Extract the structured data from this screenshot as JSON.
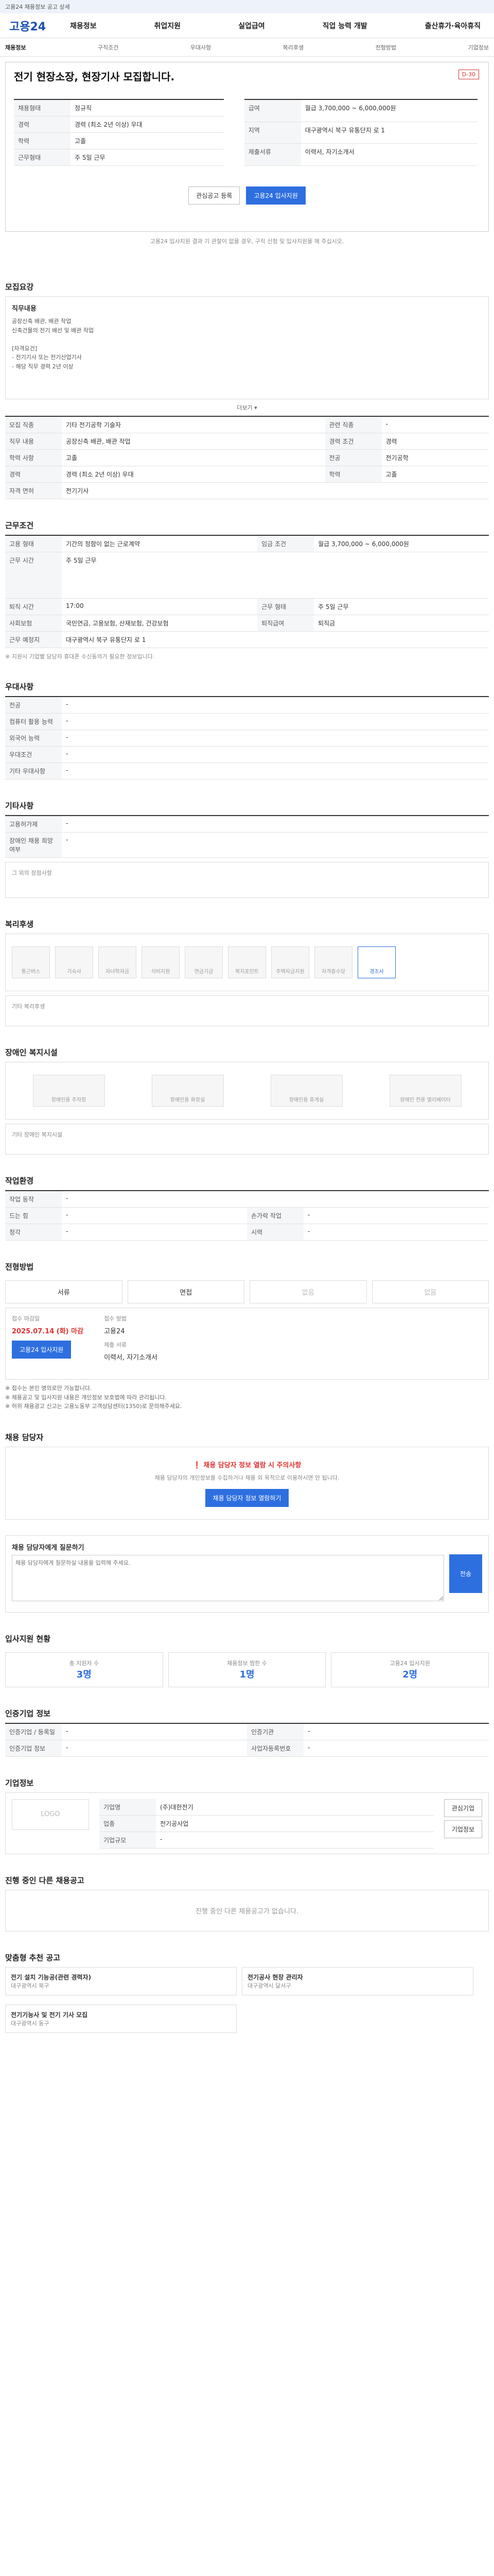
{
  "topbar": {
    "text": "고용24 채용정보 공고 상세"
  },
  "gnb": {
    "logo": "고용24",
    "menu": [
      "채용정보",
      "취업지원",
      "실업급여",
      "직업 능력 개발",
      "출산휴가·육아휴직"
    ]
  },
  "subnav": {
    "left": "채용정보",
    "crumbs": [
      "구직조건",
      "우대사항",
      "복리후생",
      "전형방법",
      "기업정보"
    ]
  },
  "job": {
    "title": "전기 현장소장, 현장기사 모집합니다.",
    "dday": "D-30",
    "left": [
      {
        "k": "채용형태",
        "v": "정규직"
      },
      {
        "k": "경력",
        "v": "경력 (최소 2년 이상) 우대"
      },
      {
        "k": "학력",
        "v": "고졸"
      },
      {
        "k": "근무형태",
        "v": "주 5일 근무"
      }
    ],
    "right": [
      {
        "k": "급여",
        "v": "월급 3,700,000 ~ 6,000,000원"
      },
      {
        "k": "지역",
        "v": "대구광역시 북구 유통단지 로 1"
      },
      {
        "k": "제출서류",
        "v": "이력서, 자기소개서"
      }
    ],
    "btn_save": "관심공고 등록",
    "btn_apply": "고용24 입사지원",
    "notice": "고용24 입사지원 결과 기 관찰이 없을 경우, 구직 신청 및 입사지원을 해 주십시오."
  },
  "recruit": {
    "title": "모집요강",
    "summary_title": "직무내용",
    "summary": "공장신축 배관, 배관 작업\n신축건물의 전기 배선 및 배관 작업\n\n[자격요건]\n- 전기기사 또는 전기산업기사\n- 해당 직무 경력 2년 이상",
    "more": "더보기 ▾",
    "rows": [
      {
        "k": "모집 직종",
        "v": "기타 전기공학 기술자",
        "k2": "관련 직종",
        "v2": "-"
      },
      {
        "k": "직무 내용",
        "v": "공장신축 배관, 배관 작업",
        "k2": "경력 조건",
        "v2": "경력"
      },
      {
        "k": "학력 사항",
        "v": "고졸",
        "k2": "전공",
        "v2": "전기공학"
      },
      {
        "k": "경력",
        "v": "경력 (최소 2년 이상) 우대",
        "k2": "학력",
        "v2": "고졸"
      },
      {
        "k": "자격 면허",
        "v": "전기기사",
        "k2": "",
        "v2": ""
      }
    ]
  },
  "conditions": {
    "title": "근무조건",
    "rows": [
      {
        "k": "고용 형태",
        "v": "기간의 정함이 없는 근로계약",
        "k2": "임금 조건",
        "v2": "월급 3,700,000 ~ 6,000,000원"
      },
      {
        "k": "근무 시간",
        "v": "주 5일 근무",
        "k2": "",
        "v2": ""
      },
      {
        "k": "퇴직 시간",
        "v": "17:00",
        "k2": "근무 형태",
        "v2": "주 5일 근무"
      },
      {
        "k": "사회보험",
        "v": "국민연금, 고용보험, 산재보험, 건강보험",
        "k2": "퇴직급여",
        "v2": "퇴직금"
      },
      {
        "k": "근무 예정지",
        "v": "대구광역시 북구 유통단지 로 1",
        "k2": "",
        "v2": ""
      }
    ],
    "notice": "※ 지원시 기업별 담당자 휴대폰 수신동의가 필요한 정보입니다."
  },
  "preference": {
    "title": "우대사항",
    "rows": [
      {
        "k": "전공",
        "v": "-"
      },
      {
        "k": "컴퓨터 활용 능력",
        "v": "-"
      },
      {
        "k": "외국어 능력",
        "v": "-"
      },
      {
        "k": "우대조건",
        "v": "-"
      },
      {
        "k": "기타 우대사항",
        "v": "-"
      }
    ]
  },
  "other": {
    "title": "기타사항",
    "rows": [
      {
        "k": "고용허가제",
        "v": "-"
      },
      {
        "k": "장애인 채용 희망 여부",
        "v": "-"
      }
    ],
    "note": "그 외의 장점사항"
  },
  "welfare": {
    "title": "복리후생",
    "tags": [
      "통근버스",
      "기숙사",
      "자녀학자금",
      "식비지원",
      "연금기금",
      "복지포인트",
      "주택자금지원",
      "자격증수당",
      "경조사"
    ],
    "active_index": 8,
    "etc_label": "기타 복리후생"
  },
  "disabled": {
    "title": "장애인 복지시설",
    "tags": [
      "장애인용 주차장",
      "장애인용 화장실",
      "장애인용 휴게실",
      "장애인 전용 엘리베이터"
    ],
    "etc_label": "기타 장애인 복지시설"
  },
  "worktime": {
    "title": "작업환경",
    "rows": [
      {
        "k": "작업 동작",
        "v": "-",
        "k2": "",
        "v2": ""
      },
      {
        "k": "드는 힘",
        "v": "-",
        "k2": "손가락 작업",
        "v2": "-"
      },
      {
        "k": "청각",
        "v": "-",
        "k2": "시력",
        "v2": "-"
      }
    ]
  },
  "method": {
    "title": "전형방법",
    "steps": [
      "서류",
      "면접",
      "없음",
      "없음"
    ],
    "deadline_label": "접수 마감일",
    "deadline": "2025.07.14 (화) 마감",
    "apply_btn": "고용24 입사지원",
    "method_label": "접수 방법",
    "method_value": "고용24",
    "docs_label": "제출 서류",
    "docs_value": "이력서, 자기소개서",
    "notices": [
      "※ 접수는 본인 명의로만 가능합니다.",
      "※ 채용공고 및 입사지원 내용은 개인정보 보호법에 따라 관리됩니다.",
      "※ 허위 채용광고 신고는 고용노동부 고객상담센터(1350)로 문의해주세요."
    ]
  },
  "contact": {
    "title": "채용 담당자",
    "warning": "❗ 채용 담당자 정보 열람 시 주의사항",
    "warning_text": "채용 담당자의 개인정보를 수집하거나 채용 외 목적으로 이용하시면 안 됩니다.",
    "btn_view": "채용 담당자 정보 열람하기"
  },
  "qna": {
    "title": "채용 담당자에게 질문하기",
    "placeholder": "채용 담당자에게 질문하실 내용을 입력해 주세요.",
    "submit": "전송"
  },
  "stats": {
    "title": "입사지원 현황",
    "items": [
      {
        "label": "총 지원자 수",
        "value": "3명"
      },
      {
        "label": "채용정보 찜한 수",
        "value": "1명"
      },
      {
        "label": "고용24 입사지원",
        "value": "2명"
      }
    ]
  },
  "company": {
    "title": "인증기업 정보",
    "rows": [
      {
        "k": "인증기업 / 등록일",
        "v": "-",
        "k2": "인증기관",
        "v2": "-"
      },
      {
        "k": "인증기업 정보",
        "v": "-",
        "k2": "사업자등록번호",
        "v2": "-"
      }
    ]
  },
  "corp": {
    "title": "기업정보",
    "logo": "LOGO",
    "rows": [
      {
        "k": "기업명",
        "v": "(주)대한전기"
      },
      {
        "k": "업종",
        "v": "전기공사업"
      },
      {
        "k": "기업규모",
        "v": "-"
      }
    ],
    "btn_follow": "관심기업",
    "btn_more": "기업정보"
  },
  "others": {
    "title": "진행 중인 다른 채용공고",
    "empty": "진행 중인 다른 채용공고가 없습니다."
  },
  "recommend": {
    "title": "맞춤형 추천 공고",
    "items": [
      {
        "name": "전기 설치 기능공(관련 경력자)",
        "meta": "대구광역시 북구"
      },
      {
        "name": "전기공사 현장 관리자",
        "meta": "대구광역시 달서구"
      },
      {
        "name": "전기기능사 및 전기 기사 모집",
        "meta": "대구광역시 동구"
      }
    ]
  }
}
